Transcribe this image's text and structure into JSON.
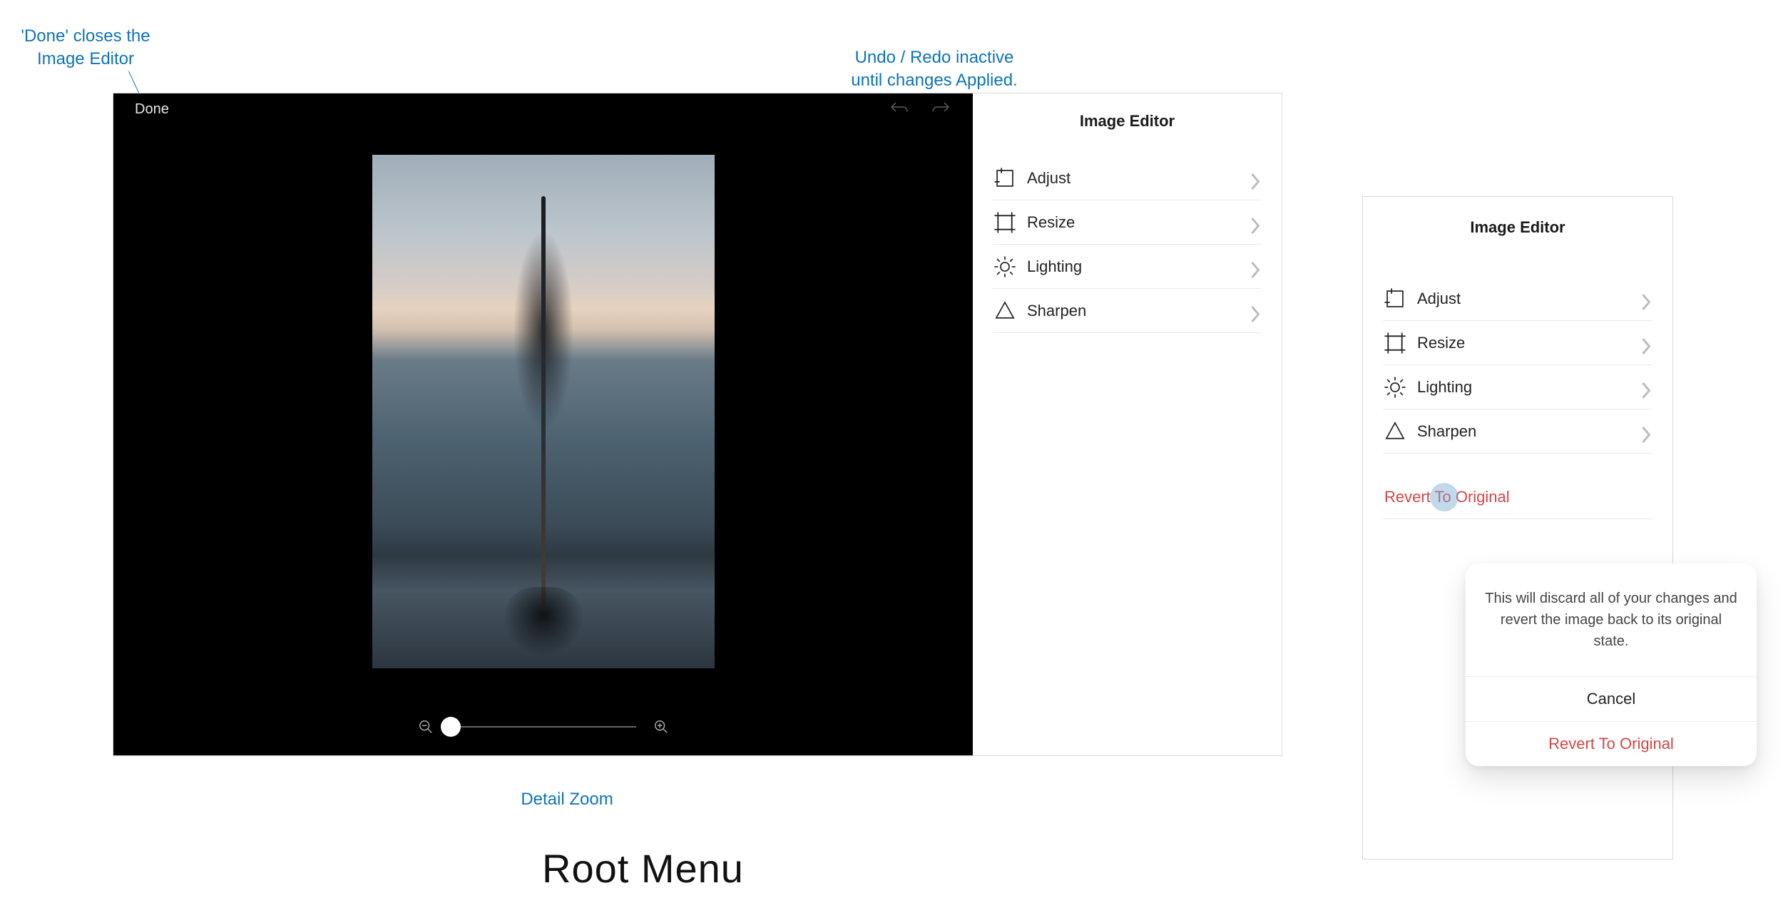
{
  "annotations": {
    "done_note_line1": "'Done' closes the",
    "done_note_line2": "Image Editor",
    "undo_note_line1": "Undo / Redo inactive",
    "undo_note_line2": "until changes Applied.",
    "zoom_note": "Detail Zoom"
  },
  "editor": {
    "done_label": "Done",
    "title": "Image Editor",
    "menu": {
      "adjust": "Adjust",
      "resize": "Resize",
      "lighting": "Lighting",
      "sharpen": "Sharpen"
    }
  },
  "panel2": {
    "title": "Image Editor",
    "revert_label": "Revert To Original"
  },
  "popover": {
    "message": "This will discard all of your changes and revert the image back to its original state.",
    "cancel": "Cancel",
    "confirm": "Revert To Original"
  },
  "heading": "Root Menu"
}
